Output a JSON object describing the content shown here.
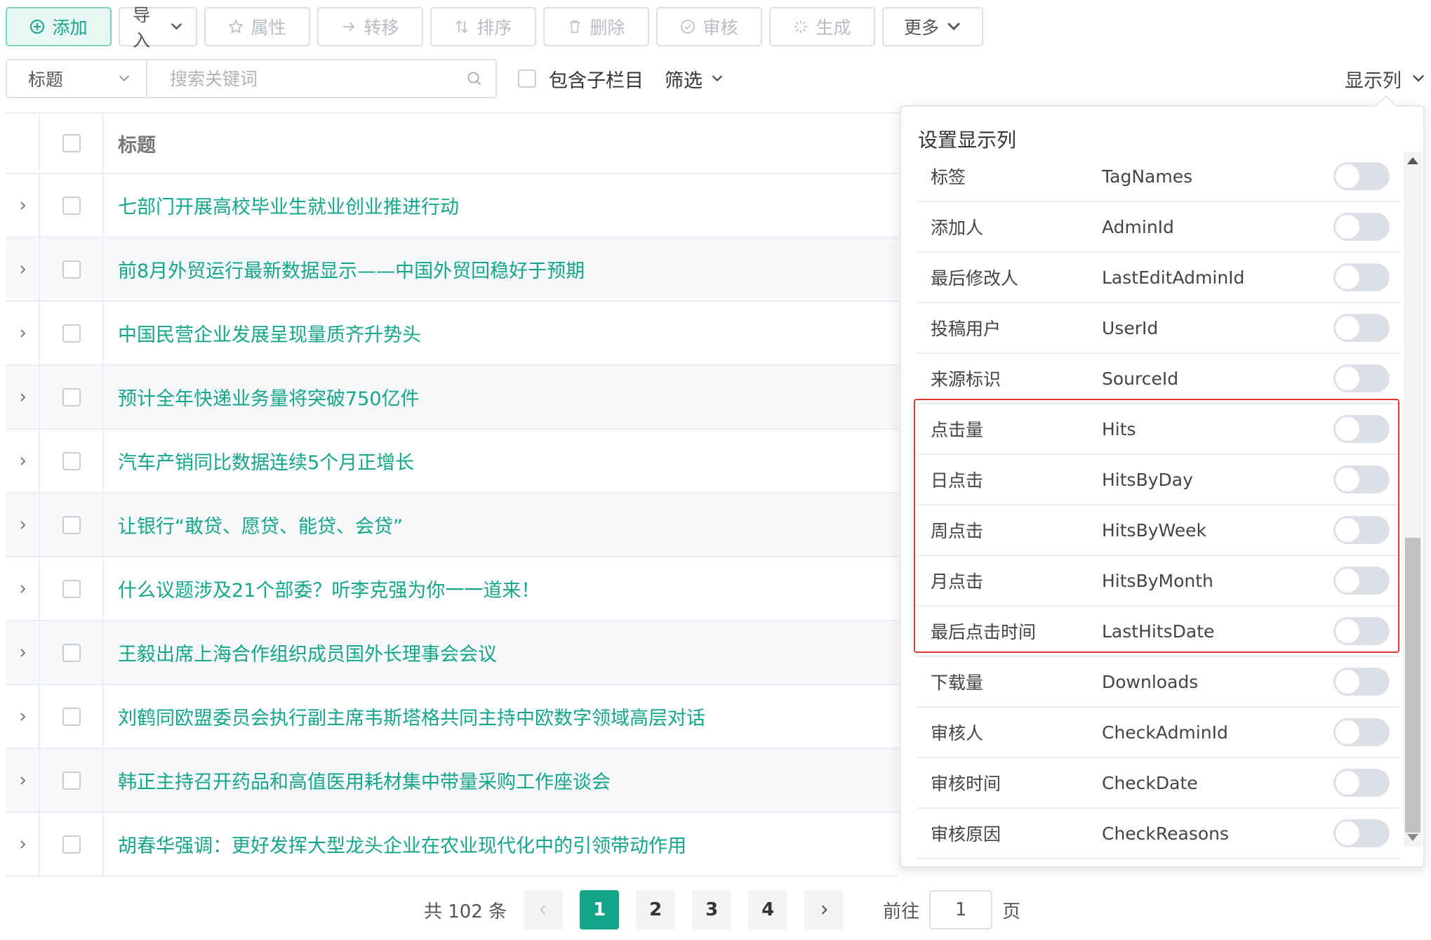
{
  "toolbar": {
    "add": "添加",
    "import": "导入",
    "attributes": "属性",
    "transfer": "转移",
    "sort": "排序",
    "delete": "删除",
    "audit": "审核",
    "generate": "生成",
    "more": "更多"
  },
  "filter": {
    "field_select": "标题",
    "search_placeholder": "搜索关键词",
    "include_sub": "包含子栏目",
    "filter_label": "筛选",
    "show_columns": "显示列"
  },
  "table": {
    "header_title": "标题",
    "rows": [
      "七部门开展高校毕业生就业创业推进行动",
      "前8月外贸运行最新数据显示——中国外贸回稳好于预期",
      "中国民营企业发展呈现量质齐升势头",
      "预计全年快递业务量将突破750亿件",
      "汽车产销同比数据连续5个月正增长",
      "让银行“敢贷、愿贷、能贷、会贷”",
      "什么议题涉及21个部委？听李克强为你一一道来！",
      "王毅出席上海合作组织成员国外长理事会会议",
      "刘鹤同欧盟委员会执行副主席韦斯塔格共同主持中欧数字领域高层对话",
      "韩正主持召开药品和高值医用耗材集中带量采购工作座谈会",
      "胡春华强调：更好发挥大型龙头企业在农业现代化中的引领带动作用"
    ]
  },
  "columns_popover": {
    "title": "设置显示列",
    "items": [
      {
        "cn": "标签",
        "en": "TagNames",
        "enabled": false
      },
      {
        "cn": "添加人",
        "en": "AdminId",
        "enabled": false
      },
      {
        "cn": "最后修改人",
        "en": "LastEditAdminId",
        "enabled": false
      },
      {
        "cn": "投稿用户",
        "en": "UserId",
        "enabled": false
      },
      {
        "cn": "来源标识",
        "en": "SourceId",
        "enabled": false
      },
      {
        "cn": "点击量",
        "en": "Hits",
        "enabled": false
      },
      {
        "cn": "日点击",
        "en": "HitsByDay",
        "enabled": false
      },
      {
        "cn": "周点击",
        "en": "HitsByWeek",
        "enabled": false
      },
      {
        "cn": "月点击",
        "en": "HitsByMonth",
        "enabled": false
      },
      {
        "cn": "最后点击时间",
        "en": "LastHitsDate",
        "enabled": false
      },
      {
        "cn": "下载量",
        "en": "Downloads",
        "enabled": false
      },
      {
        "cn": "审核人",
        "en": "CheckAdminId",
        "enabled": false
      },
      {
        "cn": "审核时间",
        "en": "CheckDate",
        "enabled": false
      },
      {
        "cn": "审核原因",
        "en": "CheckReasons",
        "enabled": false
      }
    ]
  },
  "pagination": {
    "total": "共 102 条",
    "pages": [
      "1",
      "2",
      "3",
      "4"
    ],
    "current": "1",
    "goto_prefix": "前往",
    "goto_value": "1",
    "goto_suffix": "页"
  },
  "colors": {
    "accent": "#14a58a",
    "highlight": "#e53935"
  }
}
